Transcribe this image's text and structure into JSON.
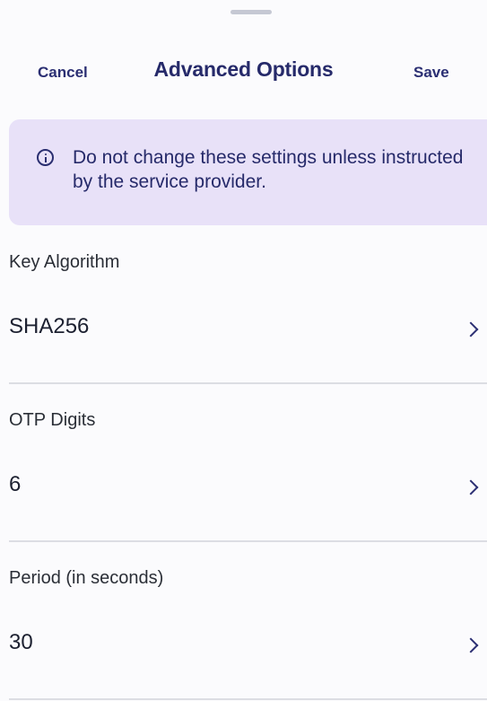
{
  "header": {
    "cancel_label": "Cancel",
    "title": "Advanced Options",
    "save_label": "Save"
  },
  "notice": {
    "icon": "info-icon",
    "text": "Do not change these settings unless instructed by the service provider."
  },
  "fields": [
    {
      "label": "Key Algorithm",
      "value": "SHA256"
    },
    {
      "label": "OTP Digits",
      "value": "6"
    },
    {
      "label": "Period (in seconds)",
      "value": "30"
    }
  ],
  "colors": {
    "accent": "#2b2f73",
    "notice_bg": "#e8e1f8",
    "background": "#fbfbfd",
    "divider": "#dcdde3"
  }
}
